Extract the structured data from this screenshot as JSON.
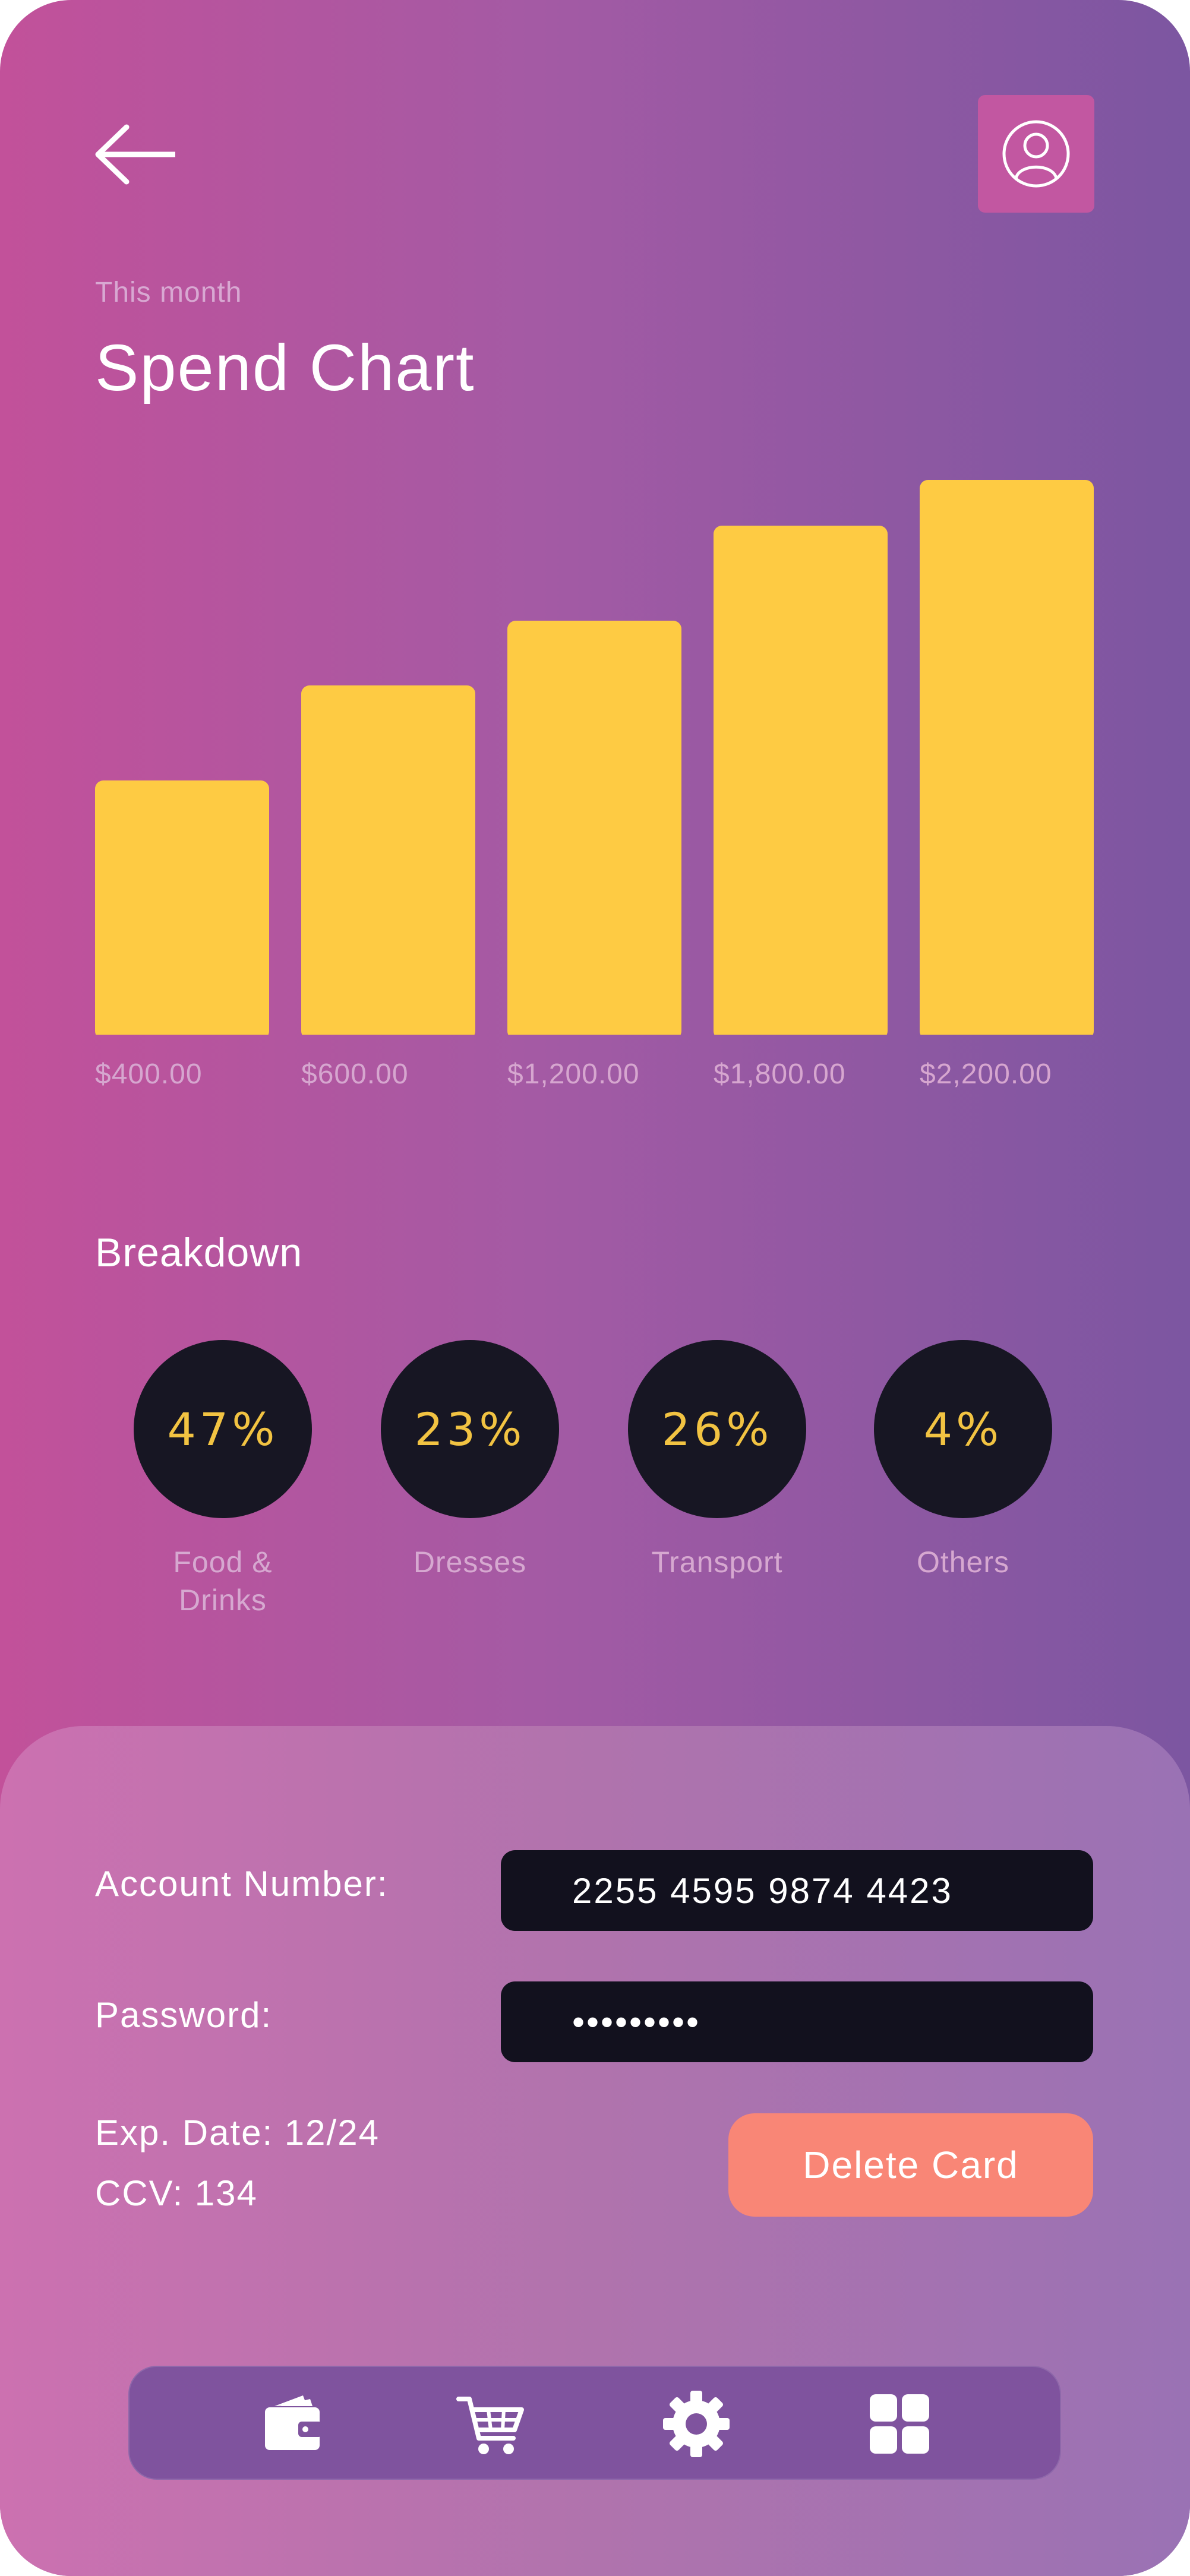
{
  "header": {
    "subtitle": "This month",
    "title": "Spend Chart"
  },
  "chart_data": {
    "type": "bar",
    "categories": [
      "$400.00",
      "$600.00",
      "$1,200.00",
      "$1,800.00",
      "$2,200.00"
    ],
    "values": [
      400,
      600,
      1200,
      1800,
      2200
    ],
    "title": "Spend Chart",
    "xlabel": "",
    "ylabel": "",
    "ylim": [
      0,
      2200
    ],
    "grid": false,
    "bar_color": "#fecb43"
  },
  "breakdown": {
    "title": "Breakdown",
    "items": [
      {
        "pct": "47%",
        "label_line1": "Food &",
        "label_line2": "Drinks"
      },
      {
        "pct": "23%",
        "label_line1": "Dresses",
        "label_line2": ""
      },
      {
        "pct": "26%",
        "label_line1": "Transport",
        "label_line2": ""
      },
      {
        "pct": "4%",
        "label_line1": "Others",
        "label_line2": ""
      }
    ]
  },
  "card": {
    "account_label": "Account Number:",
    "account_value": "2255 4595 9874 4423",
    "password_label": "Password:",
    "password_value": "•••••••••",
    "exp_date": "Exp. Date: 12/24",
    "ccv": "CCV: 134",
    "delete_label": "Delete Card"
  },
  "nav": {
    "items": [
      {
        "icon": "wallet-icon"
      },
      {
        "icon": "cart-icon"
      },
      {
        "icon": "gear-icon"
      },
      {
        "icon": "grid-icon"
      }
    ]
  },
  "colors": {
    "accent_yellow": "#fecb43",
    "circle_bg": "#171623",
    "delete_button": "#f98676",
    "navbar_bg": "#7f539e"
  }
}
